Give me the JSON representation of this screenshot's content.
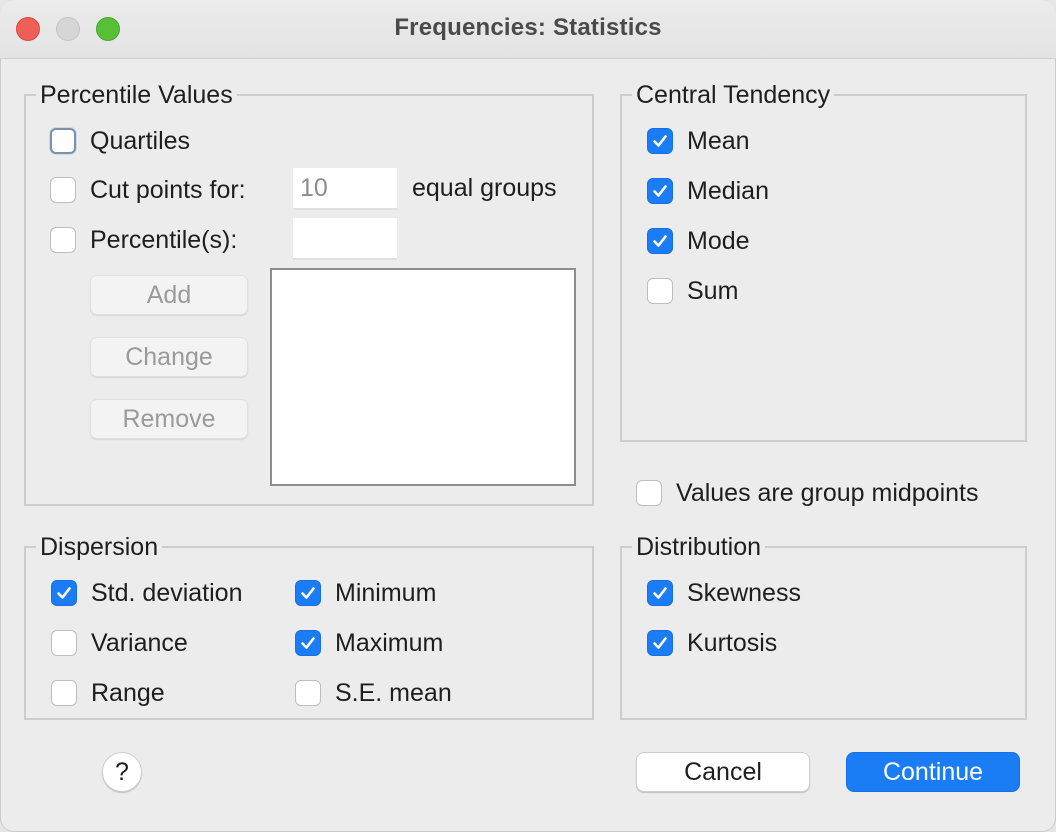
{
  "window": {
    "title": "Frequencies: Statistics"
  },
  "percentile_values": {
    "legend": "Percentile Values",
    "quartiles": {
      "label": "Quartiles",
      "checked": false
    },
    "cut_points": {
      "label": "Cut points for:",
      "value": "10",
      "suffix": "equal groups",
      "checked": false
    },
    "percentiles": {
      "label": "Percentile(s):",
      "value": "",
      "checked": false
    },
    "buttons": {
      "add": "Add",
      "change": "Change",
      "remove": "Remove"
    },
    "list": []
  },
  "central_tendency": {
    "legend": "Central Tendency",
    "items": [
      {
        "label": "Mean",
        "checked": true
      },
      {
        "label": "Median",
        "checked": true
      },
      {
        "label": "Mode",
        "checked": true
      },
      {
        "label": "Sum",
        "checked": false
      }
    ]
  },
  "group_midpoints": {
    "label": "Values are group midpoints",
    "checked": false
  },
  "dispersion": {
    "legend": "Dispersion",
    "items": [
      {
        "label": "Std. deviation",
        "checked": true
      },
      {
        "label": "Variance",
        "checked": false
      },
      {
        "label": "Range",
        "checked": false
      },
      {
        "label": "Minimum",
        "checked": true
      },
      {
        "label": "Maximum",
        "checked": true
      },
      {
        "label": "S.E. mean",
        "checked": false
      }
    ]
  },
  "distribution": {
    "legend": "Distribution",
    "items": [
      {
        "label": "Skewness",
        "checked": true
      },
      {
        "label": "Kurtosis",
        "checked": true
      }
    ]
  },
  "footer": {
    "help": "?",
    "cancel": "Cancel",
    "continue": "Continue"
  },
  "colors": {
    "accent": "#1a7df6",
    "close": "#ee5f57",
    "maximize": "#57c038"
  }
}
